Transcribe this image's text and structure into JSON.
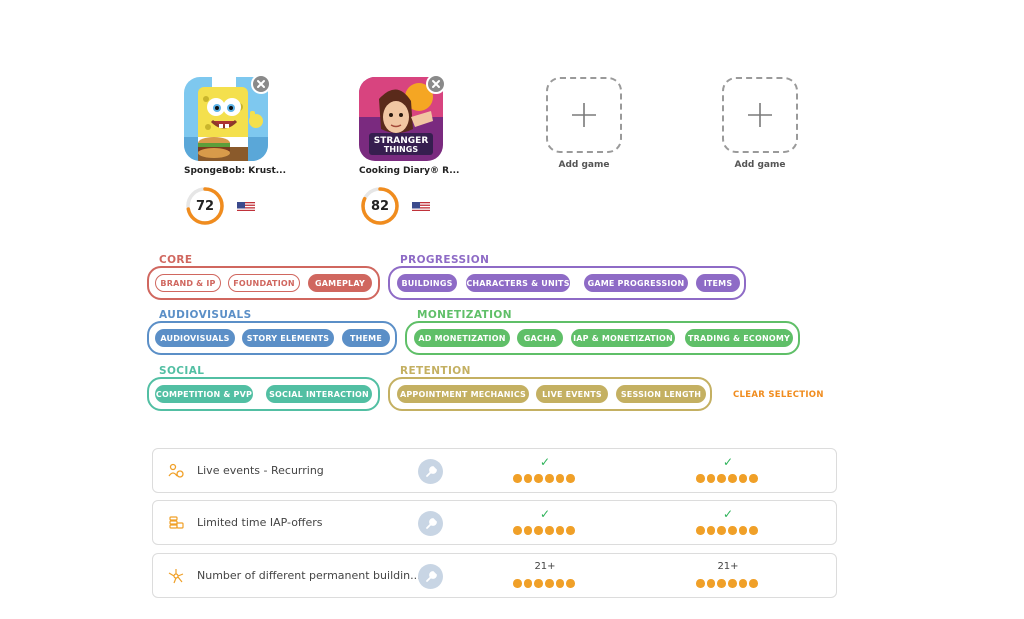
{
  "games": [
    {
      "name": "SpongeBob: Krust...",
      "score": "72",
      "score_value": 72,
      "flag": "us-flag",
      "colors": {
        "ring": "#f08c1e",
        "track": "#e6e6e6"
      }
    },
    {
      "name": "Cooking Diary® R...",
      "score": "82",
      "score_value": 82,
      "flag": "us-flag",
      "colors": {
        "ring": "#f08c1e",
        "track": "#e6e6e6"
      }
    }
  ],
  "add_slots": [
    {
      "label": "Add game"
    },
    {
      "label": "Add game"
    }
  ],
  "filters": {
    "core": {
      "title": "CORE",
      "color": "#d0675f",
      "chips": [
        "BRAND & IP",
        "FOUNDATION",
        "GAMEPLAY"
      ],
      "selected": [
        false,
        false,
        true
      ]
    },
    "progression": {
      "title": "PROGRESSION",
      "color": "#8e6bc6",
      "chips": [
        "BUILDINGS",
        "CHARACTERS & UNITS",
        "GAME PROGRESSION",
        "ITEMS"
      ]
    },
    "audiovisuals": {
      "title": "AUDIOVISUALS",
      "color": "#5b8fc7",
      "chips": [
        "AUDIOVISUALS",
        "STORY ELEMENTS",
        "THEME"
      ]
    },
    "monetization": {
      "title": "MONETIZATION",
      "color": "#5fbf68",
      "chips": [
        "AD MONETIZATION",
        "GACHA",
        "IAP & MONETIZATION",
        "TRADING & ECONOMY"
      ]
    },
    "social": {
      "title": "SOCIAL",
      "color": "#52bfa3",
      "chips": [
        "COMPETITION & PVP",
        "SOCIAL INTERACTION"
      ]
    },
    "retention": {
      "title": "RETENTION",
      "color": "#c4b062",
      "chips": [
        "APPOINTMENT MECHANICS",
        "LIVE EVENTS",
        "SESSION LENGTH"
      ]
    },
    "clear_label": "CLEAR SELECTION"
  },
  "features": [
    {
      "label": "Live events - Recurring",
      "icon": "live-events-icon",
      "values": [
        "check",
        "check"
      ],
      "dots": [
        6,
        6
      ]
    },
    {
      "label": "Limited time IAP-offers",
      "icon": "coins-icon",
      "values": [
        "check",
        "check"
      ],
      "dots": [
        6,
        6
      ]
    },
    {
      "label": "Number of different permanent buildin...",
      "icon": "network-icon",
      "values": [
        "21+",
        "21+"
      ],
      "dots": [
        6,
        6
      ]
    }
  ],
  "check_glyph": "✓",
  "colors": {
    "accent": "#f08c1e",
    "check": "#2fb35a",
    "dot": "#f0a028"
  }
}
